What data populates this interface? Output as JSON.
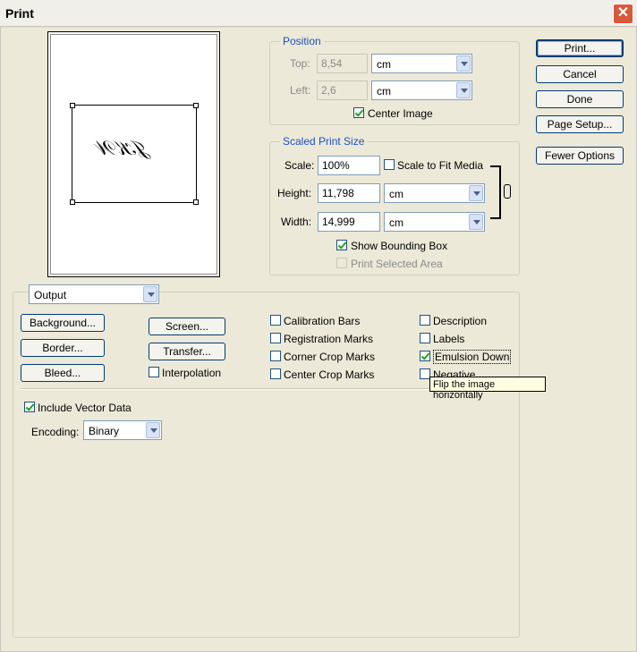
{
  "window": {
    "title": "Print",
    "close_glyph": "✕"
  },
  "position": {
    "legend": "Position",
    "top_label": "Top:",
    "top_value": "8,54",
    "top_unit": "cm",
    "left_label": "Left:",
    "left_value": "2,6",
    "left_unit": "cm",
    "center_image_label": "Center Image",
    "center_image_checked": true
  },
  "scaled": {
    "legend": "Scaled Print Size",
    "scale_label": "Scale:",
    "scale_value": "100%",
    "scale_to_fit_label": "Scale to Fit Media",
    "scale_to_fit_checked": false,
    "height_label": "Height:",
    "height_value": "11,798",
    "height_unit": "cm",
    "width_label": "Width:",
    "width_value": "14,999",
    "width_unit": "cm",
    "show_bbox_label": "Show Bounding Box",
    "show_bbox_checked": true,
    "print_selected_label": "Print Selected Area",
    "print_selected_checked": false
  },
  "buttons": {
    "print": "Print...",
    "cancel": "Cancel",
    "done": "Done",
    "page_setup": "Page Setup...",
    "fewer_options": "Fewer Options"
  },
  "output": {
    "dropdown_value": "Output",
    "background": "Background...",
    "border": "Border...",
    "bleed": "Bleed...",
    "screen": "Screen...",
    "transfer": "Transfer...",
    "interpolation": "Interpolation",
    "calibration_bars": "Calibration Bars",
    "registration_marks": "Registration Marks",
    "corner_crop_marks": "Corner Crop Marks",
    "center_crop_marks": "Center Crop Marks",
    "description": "Description",
    "labels": "Labels",
    "emulsion_down": "Emulsion Down",
    "negative": "Negative",
    "include_vector_label": "Include Vector Data",
    "encoding_label": "Encoding:",
    "encoding_value": "Binary"
  },
  "tooltip": "Flip the image horizontally",
  "preview_signature": "𝒥𝒦𝒲"
}
